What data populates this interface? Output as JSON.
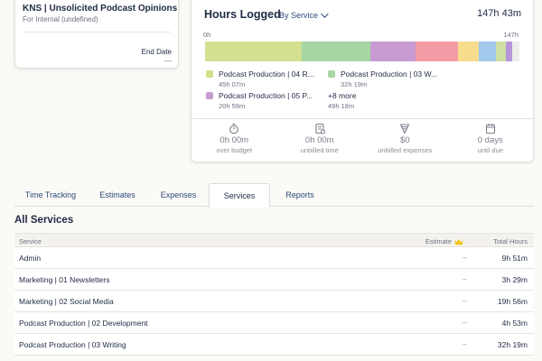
{
  "project": {
    "name": "KNS | Unsolicited Podcast Opinions",
    "client": "For Internal (undefined)",
    "end_date_label": "End Date",
    "end_date_value": "—"
  },
  "hours_logged": {
    "title": "Hours Logged",
    "group_by": "By Service",
    "total": "147h 43m",
    "axis_start": "0h",
    "axis_end": "147h",
    "bar_segments": [
      {
        "color": "#d4df8f",
        "hours": 45.12
      },
      {
        "color": "#a6d6a4",
        "hours": 32.32
      },
      {
        "color": "#c89bd3",
        "hours": 20.98
      },
      {
        "color": "#f39ca6",
        "hours": 19.93
      },
      {
        "color": "#f7dc8e",
        "hours": 9.5
      },
      {
        "color": "#a3c9ec",
        "hours": 8.0
      },
      {
        "color": "#cfe0a3",
        "hours": 4.9
      },
      {
        "color": "#b695d9",
        "hours": 2.9
      }
    ],
    "legend": [
      {
        "name": "Podcast Production | 04 R...",
        "hours": "45h 07m",
        "color": "#d4df8f"
      },
      {
        "name": "Podcast Production | 03 W...",
        "hours": "32h 19m",
        "color": "#a6d6a4"
      },
      {
        "name": "Podcast Production | 05 P...",
        "hours": "20h 59m",
        "color": "#c89bd3"
      },
      {
        "name": "+8 more",
        "hours": "49h 18m",
        "color": ""
      }
    ],
    "stats": [
      {
        "icon": "stopwatch-icon",
        "value": "0h 00m",
        "label": "over budget"
      },
      {
        "icon": "unbilled-time-icon",
        "value": "0h 00m",
        "label": "unbilled time"
      },
      {
        "icon": "receipt-icon",
        "value": "$0",
        "label": "unbilled expenses"
      },
      {
        "icon": "calendar-icon",
        "value": "0 days",
        "label": "until due"
      }
    ]
  },
  "tabs": [
    {
      "label": "Time Tracking",
      "active": false
    },
    {
      "label": "Estimates",
      "active": false
    },
    {
      "label": "Expenses",
      "active": false
    },
    {
      "label": "Services",
      "active": true
    },
    {
      "label": "Reports",
      "active": false
    }
  ],
  "services": {
    "title": "All Services",
    "headers": {
      "service": "Service",
      "estimate": "Estimate",
      "total": "Total Hours"
    },
    "estimate_icon": "crown-icon",
    "rows": [
      {
        "service": "Admin",
        "estimate": "–",
        "total": "9h 51m"
      },
      {
        "service": "Marketing | 01 Newsletters",
        "estimate": "–",
        "total": "3h 29m"
      },
      {
        "service": "Marketing | 02 Social Media",
        "estimate": "–",
        "total": "19h 56m"
      },
      {
        "service": "Podcast Production | 02 Development",
        "estimate": "–",
        "total": "4h 53m"
      },
      {
        "service": "Podcast Production | 03 Writing",
        "estimate": "–",
        "total": "32h 19m"
      }
    ]
  },
  "colors": {
    "text_primary": "#1f2a44",
    "link": "#2d4a7a",
    "muted": "#6b7280",
    "crown": "#f0c419"
  }
}
